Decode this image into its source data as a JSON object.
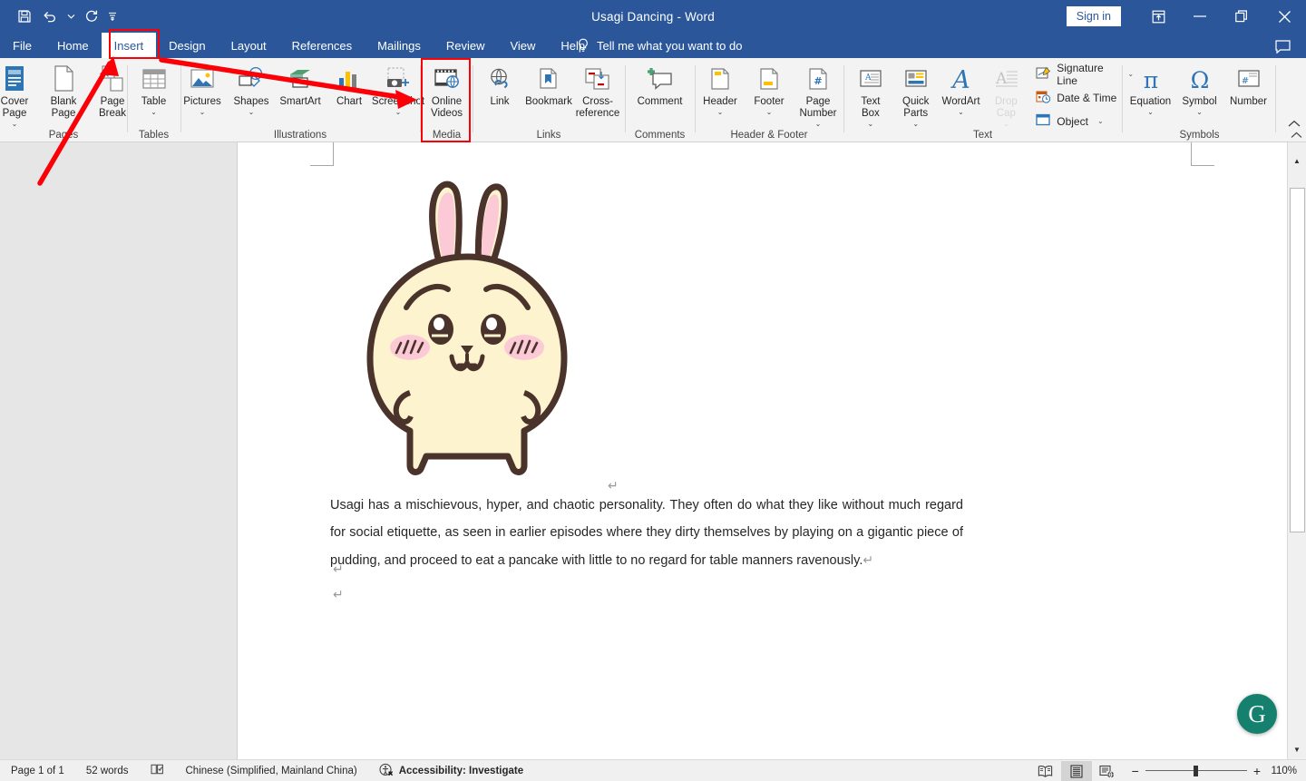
{
  "window": {
    "title": "Usagi Dancing  -  Word",
    "sign_in_label": "Sign in",
    "quick_access": [
      {
        "name": "save-icon",
        "glyph": "💾"
      },
      {
        "name": "undo-icon",
        "glyph": "↶"
      },
      {
        "name": "undo-dropdown-icon",
        "glyph": "⌄"
      },
      {
        "name": "redo-icon",
        "glyph": "↻"
      },
      {
        "name": "customize-quick-access-icon",
        "glyph": "⩟"
      }
    ],
    "controls": [
      {
        "name": "ribbon-display-options-icon",
        "glyph": "⬆"
      },
      {
        "name": "minimize-icon",
        "glyph": "─"
      },
      {
        "name": "restore-icon",
        "glyph": "❐"
      },
      {
        "name": "close-icon",
        "glyph": "✕"
      }
    ],
    "comment_icon": "comment-icon"
  },
  "tabs": [
    {
      "label": "File",
      "active": false
    },
    {
      "label": "Home",
      "active": false
    },
    {
      "label": "Insert",
      "active": true
    },
    {
      "label": "Design",
      "active": false
    },
    {
      "label": "Layout",
      "active": false
    },
    {
      "label": "References",
      "active": false
    },
    {
      "label": "Mailings",
      "active": false
    },
    {
      "label": "Review",
      "active": false
    },
    {
      "label": "View",
      "active": false
    },
    {
      "label": "Help",
      "active": false
    }
  ],
  "tell_me": {
    "label": "Tell me what you want to do",
    "icon": "lightbulb-icon"
  },
  "ribbon": {
    "groups": [
      {
        "name": "Pages",
        "label": "Pages",
        "items": [
          {
            "label": "Cover\nPage",
            "caret": true,
            "icon": "cover-page-icon"
          },
          {
            "label": "Blank\nPage",
            "caret": false,
            "icon": "blank-page-icon"
          },
          {
            "label": "Page\nBreak",
            "caret": false,
            "icon": "page-break-icon"
          }
        ]
      },
      {
        "name": "Tables",
        "label": "Tables",
        "items": [
          {
            "label": "Table",
            "caret": true,
            "icon": "table-icon"
          }
        ]
      },
      {
        "name": "Illustrations",
        "label": "Illustrations",
        "items": [
          {
            "label": "Pictures",
            "caret": true,
            "icon": "pictures-icon"
          },
          {
            "label": "Shapes",
            "caret": true,
            "icon": "shapes-icon"
          },
          {
            "label": "SmartArt",
            "caret": false,
            "icon": "smartart-icon"
          },
          {
            "label": "Chart",
            "caret": false,
            "icon": "chart-icon"
          },
          {
            "label": "Screenshot",
            "caret": true,
            "icon": "screenshot-icon"
          }
        ]
      },
      {
        "name": "Media",
        "label": "Media",
        "items": [
          {
            "label": "Online\nVideos",
            "caret": false,
            "icon": "online-videos-icon"
          }
        ]
      },
      {
        "name": "Links",
        "label": "Links",
        "items": [
          {
            "label": "Link",
            "caret": false,
            "icon": "link-icon"
          },
          {
            "label": "Bookmark",
            "caret": false,
            "icon": "bookmark-icon"
          },
          {
            "label": "Cross-\nreference",
            "caret": false,
            "icon": "cross-reference-icon"
          }
        ]
      },
      {
        "name": "Comments",
        "label": "Comments",
        "items": [
          {
            "label": "Comment",
            "caret": false,
            "icon": "new-comment-icon"
          }
        ]
      },
      {
        "name": "Header & Footer",
        "label": "Header & Footer",
        "items": [
          {
            "label": "Header",
            "caret": true,
            "icon": "header-icon"
          },
          {
            "label": "Footer",
            "caret": true,
            "icon": "footer-icon"
          },
          {
            "label": "Page\nNumber",
            "caret": true,
            "icon": "page-number-icon"
          }
        ]
      },
      {
        "name": "Text",
        "label": "Text",
        "items": [
          {
            "label": "Text\nBox",
            "caret": true,
            "icon": "text-box-icon"
          },
          {
            "label": "Quick\nParts",
            "caret": true,
            "icon": "quick-parts-icon"
          },
          {
            "label": "WordArt",
            "caret": true,
            "icon": "wordart-icon"
          },
          {
            "label": "Drop\nCap",
            "caret": true,
            "icon": "drop-cap-icon",
            "disabled": true
          }
        ],
        "small_items": [
          {
            "label": "Signature Line",
            "caret": true,
            "icon": "signature-line-icon"
          },
          {
            "label": "Date & Time",
            "caret": false,
            "icon": "date-time-icon"
          },
          {
            "label": "Object",
            "caret": true,
            "icon": "object-icon"
          }
        ]
      },
      {
        "name": "Symbols",
        "label": "Symbols",
        "items": [
          {
            "label": "Equation",
            "caret": true,
            "icon": "equation-icon"
          },
          {
            "label": "Symbol",
            "caret": true,
            "icon": "symbol-icon"
          },
          {
            "label": "Number",
            "caret": false,
            "icon": "number-icon"
          }
        ]
      }
    ],
    "collapse_icon": "collapse-ribbon-icon"
  },
  "document": {
    "image_alt": "usagi-rabbit-illustration",
    "paragraph": "Usagi has a mischievous, hyper, and chaotic personality. They often do what they like without much regard for social etiquette, as seen in earlier episodes where they dirty themselves by playing on a gigantic piece of pudding, and proceed to eat a pancake with little to no regard for table manners ravenously.",
    "pilcrow": "↵"
  },
  "status_bar": {
    "page": "Page 1 of 1",
    "words": "52 words",
    "proofing_icon": "proofing-icon",
    "language": "Chinese (Simplified, Mainland China)",
    "accessibility": "Accessibility: Investigate",
    "accessibility_icon": "accessibility-icon",
    "views": [
      {
        "name": "read-mode-view-button",
        "active": false
      },
      {
        "name": "print-layout-view-button",
        "active": true
      },
      {
        "name": "web-layout-view-button",
        "active": false
      }
    ],
    "zoom_out": "−",
    "zoom_in": "+",
    "zoom_level": "110%"
  },
  "annotations": {
    "highlight_color": "#fb0007",
    "boxes": [
      {
        "name": "insert-tab-highlight"
      },
      {
        "name": "online-videos-highlight"
      }
    ],
    "arrows": [
      {
        "name": "arrow-to-insert-tab"
      },
      {
        "name": "arrow-to-online-videos"
      }
    ]
  },
  "grammarly": {
    "label": "G",
    "name": "grammarly-button"
  }
}
